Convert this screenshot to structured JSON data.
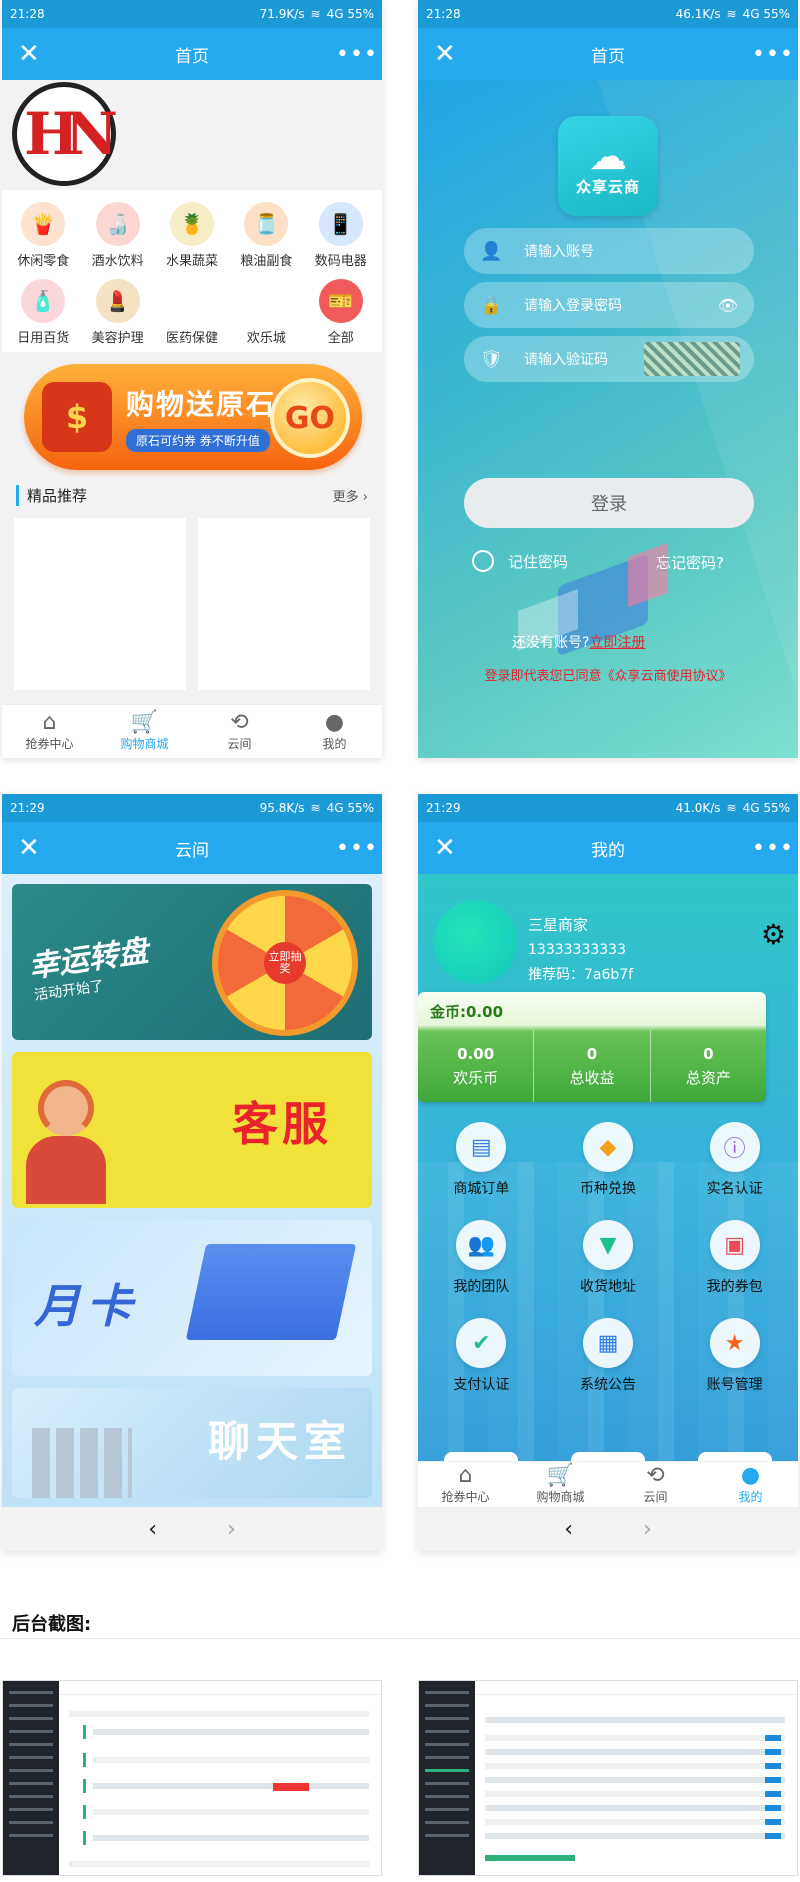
{
  "colors": {
    "accent": "#24a9ef",
    "red": "#e8232b",
    "coin_green": "#3ea83a"
  },
  "panel_home": {
    "status": {
      "time": "21:28",
      "speed": "71.9K/s",
      "battery": "4G 55%"
    },
    "title": "首页",
    "logo_letters": "HN",
    "categories": [
      "休闲零食",
      "酒水饮料",
      "水果蔬菜",
      "粮油副食",
      "数码电器",
      "日用百货",
      "美容护理",
      "医药保健",
      "欢乐城",
      "全部"
    ],
    "banner": {
      "headline": "购物送原石",
      "sub": "原石可约券 券不断升值",
      "go": "GO"
    },
    "section_title": "精品推荐",
    "more": "更多",
    "tabs": [
      "抢券中心",
      "购物商城",
      "云间",
      "我的"
    ]
  },
  "panel_login": {
    "status": {
      "time": "21:28",
      "speed": "46.1K/s",
      "battery": "4G 55%"
    },
    "title": "首页",
    "app_name": "众享云商",
    "account_placeholder": "请输入账号",
    "password_placeholder": "请输入登录密码",
    "captcha_placeholder": "请输入验证码",
    "login_button": "登录",
    "remember": "记住密码",
    "forgot": "忘记密码?",
    "no_account": "还没有账号?",
    "register": "立即注册",
    "agreement": "登录即代表您已同意《众享云商使用协议》"
  },
  "panel_cloud": {
    "status": {
      "time": "21:29",
      "speed": "95.8K/s",
      "battery": "4G 55%"
    },
    "title": "云间",
    "promos": {
      "wheel_title": "幸运转盘",
      "wheel_sub": "活动开始了",
      "wheel_center": "立即抽奖",
      "kefu": "客服",
      "yueka": "月卡",
      "chat": "聊天室"
    },
    "nav_back": "‹",
    "nav_forward": "›"
  },
  "panel_me": {
    "status": {
      "time": "21:29",
      "speed": "41.0K/s",
      "battery": "4G 55%"
    },
    "title": "我的",
    "user_name": "三星商家",
    "user_phone": "13333333333",
    "user_code": "推荐码：7a6b7f",
    "coins": "金币:0.00",
    "stats": [
      {
        "value": "0.00",
        "label": "欢乐币"
      },
      {
        "value": "0",
        "label": "总收益"
      },
      {
        "value": "0",
        "label": "总资产"
      }
    ],
    "menu": [
      "商城订单",
      "币种兑换",
      "实名认证",
      "我的团队",
      "收货地址",
      "我的券包",
      "支付认证",
      "系统公告",
      "账号管理"
    ],
    "tabs": [
      "抢券中心",
      "购物商城",
      "云间",
      "我的"
    ],
    "nav_back": "‹",
    "nav_forward": "›"
  },
  "backend_title": "后台截图:"
}
